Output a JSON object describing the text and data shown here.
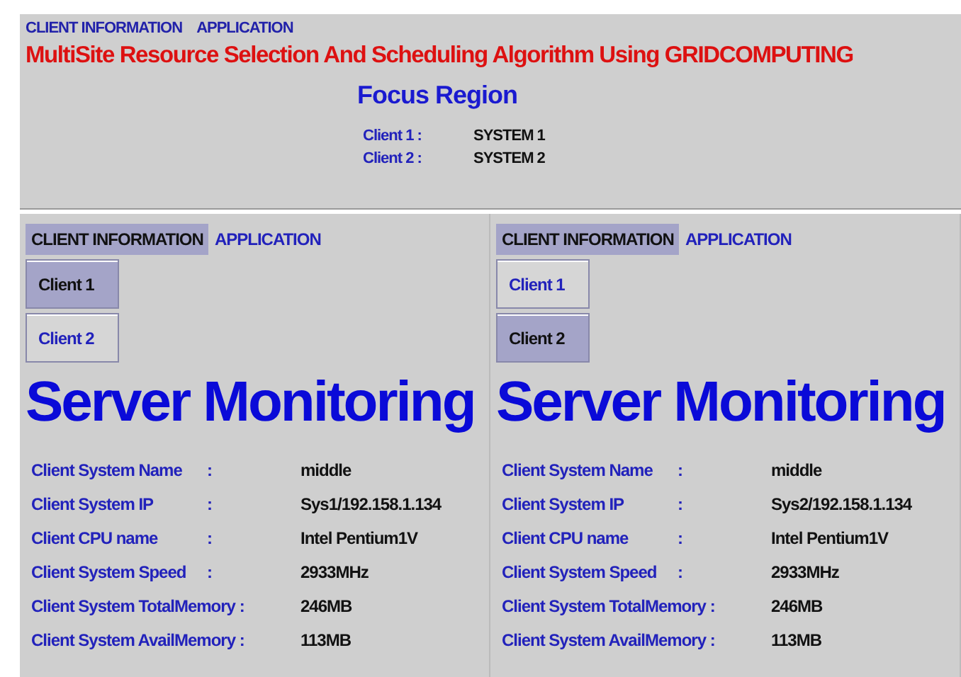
{
  "top_tabs": [
    {
      "label": "CLIENT INFORMATION"
    },
    {
      "label": "APPLICATION"
    }
  ],
  "title": "MultiSite Resource Selection And Scheduling Algorithm Using GRIDCOMPUTING",
  "subtitle": "Focus Region",
  "clients": [
    {
      "label": "Client 1 :",
      "value": "SYSTEM 1"
    },
    {
      "label": "Client 2 :",
      "value": "SYSTEM 2"
    }
  ],
  "panels": [
    {
      "tabs": [
        {
          "label": "CLIENT INFORMATION",
          "selected": true
        },
        {
          "label": "APPLICATION",
          "selected": false
        }
      ],
      "client_buttons": [
        {
          "label": "Client 1",
          "selected": true
        },
        {
          "label": "Client 2",
          "selected": false
        }
      ],
      "heading": "Server Monitoring",
      "rows": [
        {
          "label": "Client System Name",
          "colon": ":",
          "value": "middle"
        },
        {
          "label": "Client System IP",
          "colon": ":",
          "value": "Sys1/192.158.1.134"
        },
        {
          "label": "Client CPU name",
          "colon": ":",
          "value": "Intel Pentium1V"
        },
        {
          "label": "Client System Speed",
          "colon": ":",
          "value": "2933MHz"
        },
        {
          "label": "Client System TotalMemory :",
          "value": "246MB"
        },
        {
          "label": "Client System AvailMemory :",
          "value": "113MB"
        }
      ]
    },
    {
      "tabs": [
        {
          "label": "CLIENT INFORMATION",
          "selected": true
        },
        {
          "label": "APPLICATION",
          "selected": false
        }
      ],
      "client_buttons": [
        {
          "label": "Client 1",
          "selected": false
        },
        {
          "label": "Client 2",
          "selected": true
        }
      ],
      "heading": "Server Monitoring",
      "rows": [
        {
          "label": "Client System Name",
          "colon": ":",
          "value": "middle"
        },
        {
          "label": "Client System IP",
          "colon": ":",
          "value": "Sys2/192.158.1.134"
        },
        {
          "label": "Client CPU name",
          "colon": ":",
          "value": "Intel Pentium1V"
        },
        {
          "label": "Client System Speed",
          "colon": ":",
          "value": "2933MHz"
        },
        {
          "label": "Client System TotalMemory :",
          "value": "246MB"
        },
        {
          "label": "Client System AvailMemory :",
          "value": "113MB"
        }
      ]
    }
  ]
}
